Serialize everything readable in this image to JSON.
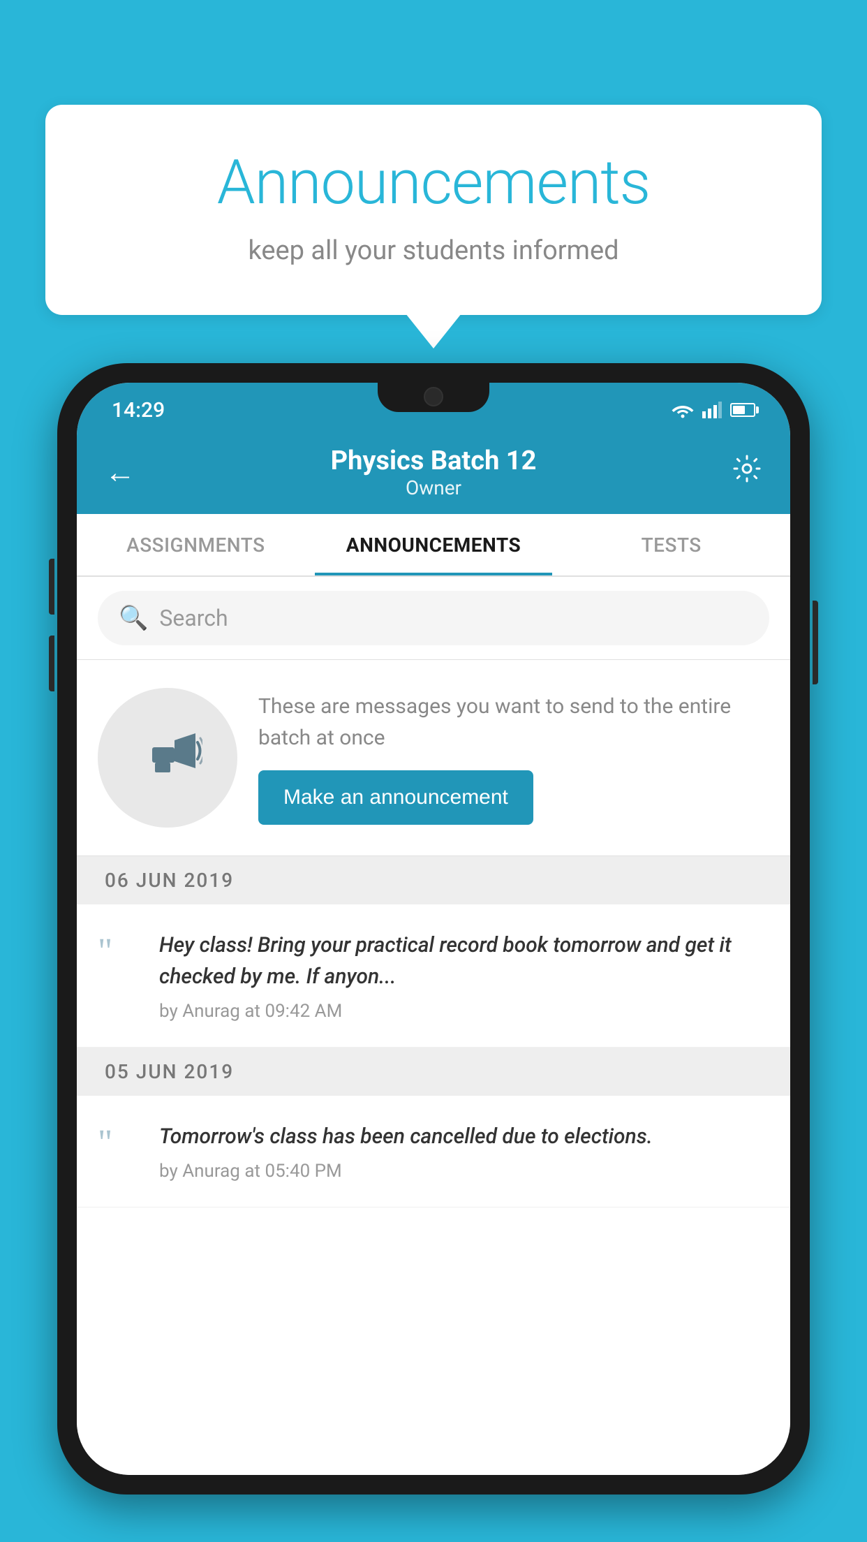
{
  "background_color": "#29b6d8",
  "speech_bubble": {
    "title": "Announcements",
    "subtitle": "keep all your students informed"
  },
  "phone": {
    "status_bar": {
      "time": "14:29"
    },
    "header": {
      "title": "Physics Batch 12",
      "subtitle": "Owner",
      "back_label": "←",
      "settings_label": "⚙"
    },
    "tabs": [
      {
        "label": "ASSIGNMENTS",
        "active": false
      },
      {
        "label": "ANNOUNCEMENTS",
        "active": true
      },
      {
        "label": "TESTS",
        "active": false
      }
    ],
    "search": {
      "placeholder": "Search"
    },
    "empty_state": {
      "description": "These are messages you want to send to the entire batch at once",
      "button_label": "Make an announcement"
    },
    "announcements": [
      {
        "date": "06  JUN  2019",
        "text": "Hey class! Bring your practical record book tomorrow and get it checked by me. If anyon...",
        "meta": "by Anurag at 09:42 AM"
      },
      {
        "date": "05  JUN  2019",
        "text": "Tomorrow's class has been cancelled due to elections.",
        "meta": "by Anurag at 05:40 PM"
      }
    ]
  }
}
